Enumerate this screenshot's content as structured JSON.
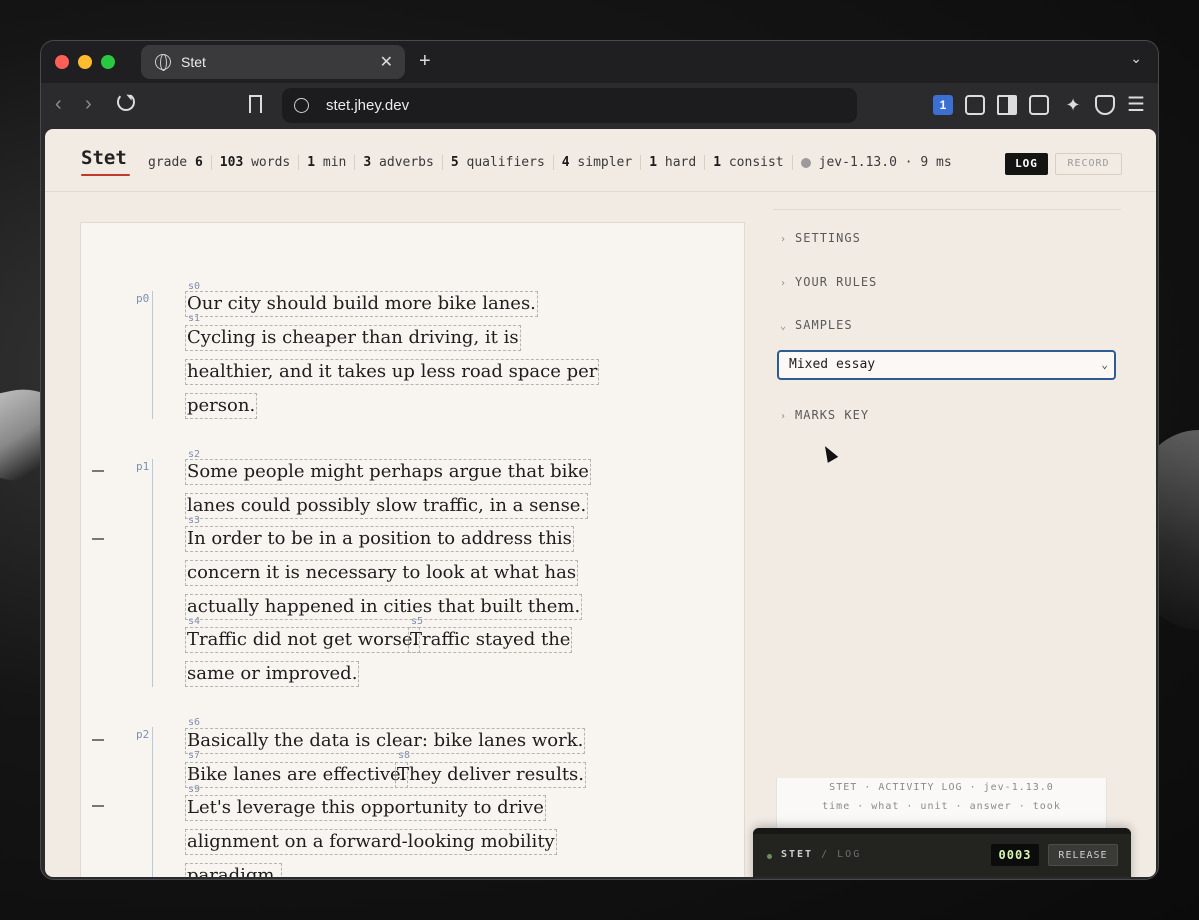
{
  "browser": {
    "tab_title": "Stet",
    "tab_close": "✕",
    "new_tab": "+",
    "url": "stet.jhey.dev",
    "extension_badge": "1"
  },
  "app": {
    "logo": "Stet",
    "stats": [
      {
        "label": "grade ",
        "value": "6"
      },
      {
        "label": " words",
        "value": "103",
        "value_first": true
      },
      {
        "label": " min",
        "value": "1",
        "value_first": true
      },
      {
        "label": " adverbs",
        "value": "3",
        "value_first": true
      },
      {
        "label": " qualifiers",
        "value": "5",
        "value_first": true
      },
      {
        "label": " simpler",
        "value": "4",
        "value_first": true
      },
      {
        "label": " hard",
        "value": "1",
        "value_first": true
      },
      {
        "label": " consist",
        "value": "1",
        "value_first": true
      }
    ],
    "status_text": "jev-1.13.0 · 9 ms",
    "log_button": "LOG",
    "record_button": "RECORD"
  },
  "document": {
    "paragraphs": [
      {
        "id": "p0"
      },
      {
        "id": "p1"
      },
      {
        "id": "p2"
      }
    ],
    "sentence_labels": [
      "s0",
      "s1",
      "s2",
      "s3",
      "s4",
      "s5",
      "s6",
      "s7",
      "s8",
      "s9"
    ],
    "lines": [
      "Our city should build more bike lanes.",
      "Cycling is cheaper than driving, it is",
      "healthier, and it takes up less road space per",
      "person.",
      "Some people might perhaps argue that bike",
      "lanes could possibly slow traffic, in a sense.",
      "In order to be in a position to address this",
      "concern it is necessary to look at what has",
      "actually happened in cities that built them.",
      "Traffic did not get worse.",
      "Traffic stayed the",
      "same or improved.",
      "Basically the data is clear: bike lanes work.",
      "Bike lanes are effective.",
      "They deliver results.",
      "Let's leverage this opportunity to drive",
      "alignment on a forward-looking mobility",
      "paradigm."
    ]
  },
  "sidebar": {
    "sections": [
      "SETTINGS",
      "YOUR RULES",
      "SAMPLES",
      "MARKS KEY"
    ],
    "sample_select": "Mixed essay"
  },
  "activity_log": {
    "header": "STET · ACTIVITY LOG · jev-1.13.0",
    "columns": "time · what · unit · answer · took",
    "dock_label": "STET",
    "dock_label_dim": " / LOG",
    "counter": "0003",
    "release_button": "RELEASE"
  }
}
